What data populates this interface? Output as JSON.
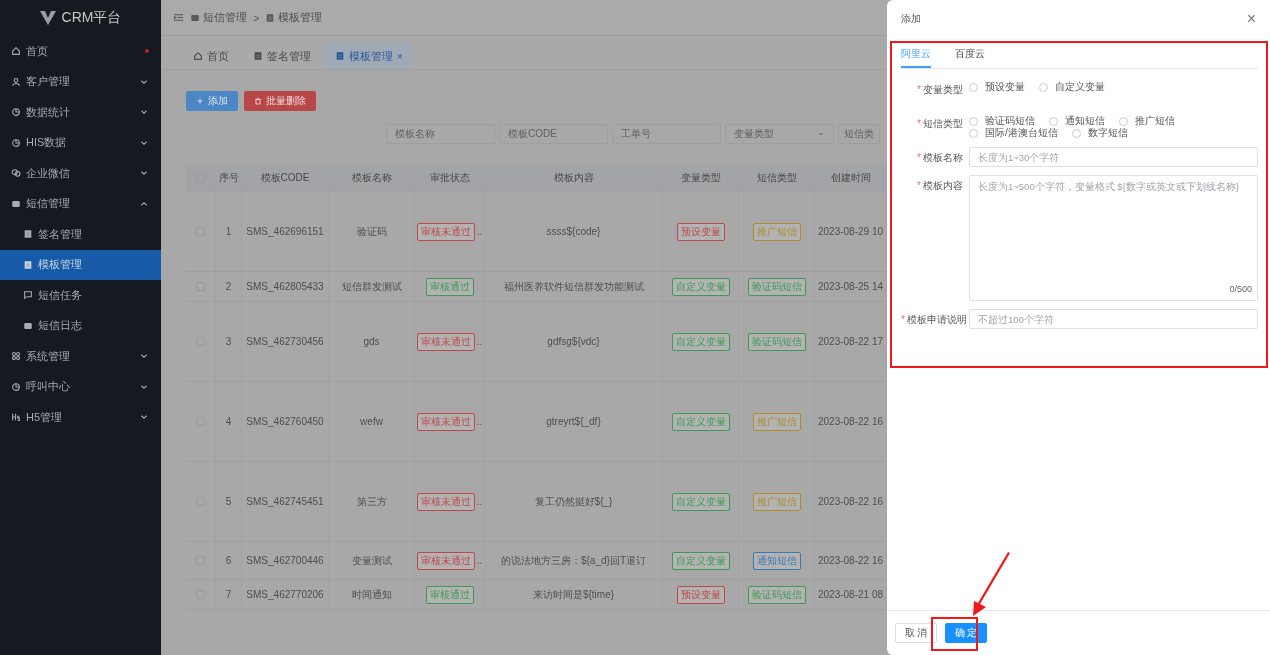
{
  "sidebar": {
    "logo": "CRM平台",
    "items": [
      {
        "label": "首页",
        "dot": true,
        "selected": false
      },
      {
        "label": "客户管理",
        "expanded": false,
        "selected": false
      },
      {
        "label": "数据统计",
        "expanded": false,
        "selected": false
      },
      {
        "label": "HIS数据",
        "expanded": false,
        "selected": false
      },
      {
        "label": "企业微信",
        "expanded": false,
        "selected": false
      },
      {
        "label": "短信管理",
        "expanded": true,
        "selected": false,
        "children": [
          {
            "label": "签名管理",
            "selected": false
          },
          {
            "label": "模板管理",
            "selected": true
          },
          {
            "label": "短信任务",
            "selected": false
          },
          {
            "label": "短信日志",
            "selected": false
          }
        ]
      },
      {
        "label": "系统管理",
        "expanded": false,
        "selected": false
      },
      {
        "label": "呼叫中心",
        "expanded": false,
        "selected": false
      },
      {
        "label": "H5管理",
        "expanded": false,
        "selected": false
      }
    ]
  },
  "breadcrumb": [
    "短信管理",
    "模板管理"
  ],
  "breadcrumb_separator": ">",
  "tabs": [
    {
      "label": "首页",
      "selected": false
    },
    {
      "label": "签名管理",
      "selected": false
    },
    {
      "label": "模板管理",
      "selected": true,
      "close": "×"
    }
  ],
  "actions": [
    {
      "label": "添加",
      "kind": "primary"
    },
    {
      "label": "批量删除",
      "kind": "danger"
    }
  ],
  "filters": [
    {
      "placeholder": "模板名称",
      "kind": "input"
    },
    {
      "placeholder": "模板CODE",
      "kind": "input"
    },
    {
      "placeholder": "工单号",
      "kind": "input"
    },
    {
      "placeholder": "变量类型",
      "kind": "select"
    },
    {
      "placeholder": "短信类",
      "kind": "input"
    }
  ],
  "table": {
    "header_checked": false,
    "columns": [
      "序号",
      "模板CODE",
      "模板名称",
      "审批状态",
      "模板内容",
      "变量类型",
      "短信类型",
      "创建时间"
    ],
    "rows": [
      {
        "checked": false,
        "no": "1",
        "code": "SMS_462696151",
        "name": "验证码",
        "status": {
          "text": "审核未通过",
          "color": "#c04848"
        },
        "more": "..",
        "content": "ssss${code}",
        "var_type": {
          "text": "预设变量",
          "color": "#c04848"
        },
        "sms_type": {
          "text": "推广短信",
          "color": "#b08a2c"
        },
        "created": "2023-08-29 10"
      },
      {
        "checked": false,
        "no": "2",
        "code": "SMS_462805433",
        "name": "短信群发测试",
        "status": {
          "text": "审核通过",
          "color": "#3f9a55"
        },
        "content": "福州医养软件短信群发功能测试",
        "var_type": {
          "text": "自定义变量",
          "color": "#3f9a55"
        },
        "sms_type": {
          "text": "验证码短信",
          "color": "#3f9a55"
        },
        "created": "2023-08-25 14"
      },
      {
        "checked": false,
        "no": "3",
        "code": "SMS_462730456",
        "name": "gds",
        "status": {
          "text": "审核未通过",
          "color": "#c04848"
        },
        "more": "..",
        "content": "gdfsg${vdc}",
        "var_type": {
          "text": "自定义变量",
          "color": "#3f9a55"
        },
        "sms_type": {
          "text": "验证码短信",
          "color": "#3f9a55"
        },
        "created": "2023-08-22 17"
      },
      {
        "checked": false,
        "no": "4",
        "code": "SMS_462760450",
        "name": "wefw",
        "status": {
          "text": "审核未通过",
          "color": "#c04848"
        },
        "more": "..",
        "content": "gtreyrt${_df}",
        "var_type": {
          "text": "自定义变量",
          "color": "#3f9a55"
        },
        "sms_type": {
          "text": "推广短信",
          "color": "#b08a2c"
        },
        "created": "2023-08-22 16"
      },
      {
        "checked": false,
        "no": "5",
        "code": "SMS_462745451",
        "name": "第三方",
        "status": {
          "text": "审核未通过",
          "color": "#c04848"
        },
        "more": "..",
        "content": "复工仍然挺好${_}",
        "var_type": {
          "text": "自定义变量",
          "color": "#3f9a55"
        },
        "sms_type": {
          "text": "推广短信",
          "color": "#b08a2c"
        },
        "created": "2023-08-22 16"
      },
      {
        "checked": false,
        "no": "6",
        "code": "SMS_462700446",
        "name": "变量测试",
        "status": {
          "text": "审核未通过",
          "color": "#c04848"
        },
        "more": "..",
        "content": "的说法地方三房：${a_d}回T退订",
        "var_type": {
          "text": "自定义变量",
          "color": "#3f9a55"
        },
        "sms_type": {
          "text": "通知短信",
          "color": "#3f77b4"
        },
        "created": "2023-08-22 16"
      },
      {
        "checked": false,
        "no": "7",
        "code": "SMS_462770206",
        "name": "时间通知",
        "status": {
          "text": "审核通过",
          "color": "#3f9a55"
        },
        "content": "来访时间是${time}",
        "var_type": {
          "text": "预设变量",
          "color": "#c04848"
        },
        "sms_type": {
          "text": "验证码短信",
          "color": "#3f9a55"
        },
        "created": "2023-08-21 08"
      }
    ]
  },
  "drawer": {
    "title": "添加",
    "close": "×",
    "tabs": [
      {
        "label": "阿里云",
        "selected": true
      },
      {
        "label": "百度云",
        "selected": false
      }
    ],
    "fields": [
      {
        "label": "变量类型",
        "kind": "radio",
        "options": [
          {
            "label": "预设变量",
            "checked": false
          },
          {
            "label": "自定义变量",
            "checked": false
          }
        ]
      },
      {
        "label": "短信类型",
        "kind": "radio",
        "options": [
          {
            "label": "验证码短信",
            "checked": false
          },
          {
            "label": "通知短信",
            "checked": false
          },
          {
            "label": "推广短信",
            "checked": false
          },
          {
            "label": "国际/港澳台短信",
            "checked": false
          },
          {
            "label": "数字短信",
            "checked": false
          }
        ]
      },
      {
        "label": "模板名称",
        "kind": "input",
        "placeholder": "长度为1~30个字符"
      },
      {
        "label": "模板内容",
        "kind": "textarea",
        "placeholder": "长度为1~500个字符，变量格式 ${数字或英文或下划线名称}",
        "counter": "0/500"
      },
      {
        "label": "模板申请说明",
        "kind": "input",
        "placeholder": "不超过100个字符"
      }
    ],
    "required_mark": "*",
    "buttons": [
      {
        "label": "取 消",
        "kind": "default"
      },
      {
        "label": "确 定",
        "kind": "primary"
      }
    ]
  }
}
